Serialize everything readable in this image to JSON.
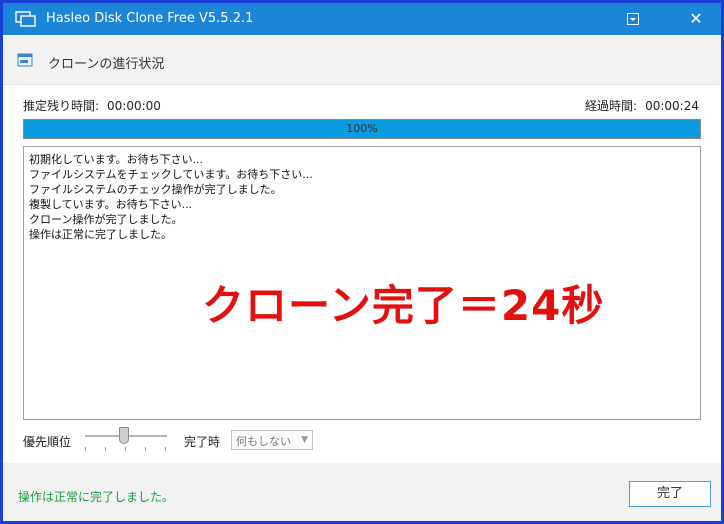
{
  "window": {
    "title": "Hasleo Disk Clone Free V5.5.2.1",
    "menu_icon": "dropdown-menu-icon",
    "close_glyph": "✕"
  },
  "header": {
    "title": "クローンの進行状況"
  },
  "time": {
    "remaining_label": "推定残り時間:",
    "remaining_value": "00:00:00",
    "elapsed_label": "経過時間:",
    "elapsed_value": "00:00:24"
  },
  "progress": {
    "percent": 100,
    "label": "100%",
    "color": "#0a9be0"
  },
  "log": {
    "lines": [
      "初期化しています。お待ち下さい...",
      "ファイルシステムをチェックしています。お待ち下さい...",
      "ファイルシステムのチェック操作が完了しました。",
      "複製しています。お待ち下さい...",
      "クローン操作が完了しました。",
      "操作は正常に完了しました。"
    ],
    "overlay_text": "クローン完了＝24秒",
    "overlay_color": "#e4100f"
  },
  "options": {
    "priority_label": "優先順位",
    "completion_label": "完了時",
    "completion_value": "何もしない"
  },
  "footer": {
    "status": "操作は正常に完了しました。",
    "status_color": "#1a9a42",
    "done_label": "完了"
  },
  "colors": {
    "titlebar": "#1d85d8",
    "frame": "#1a3fd6"
  }
}
